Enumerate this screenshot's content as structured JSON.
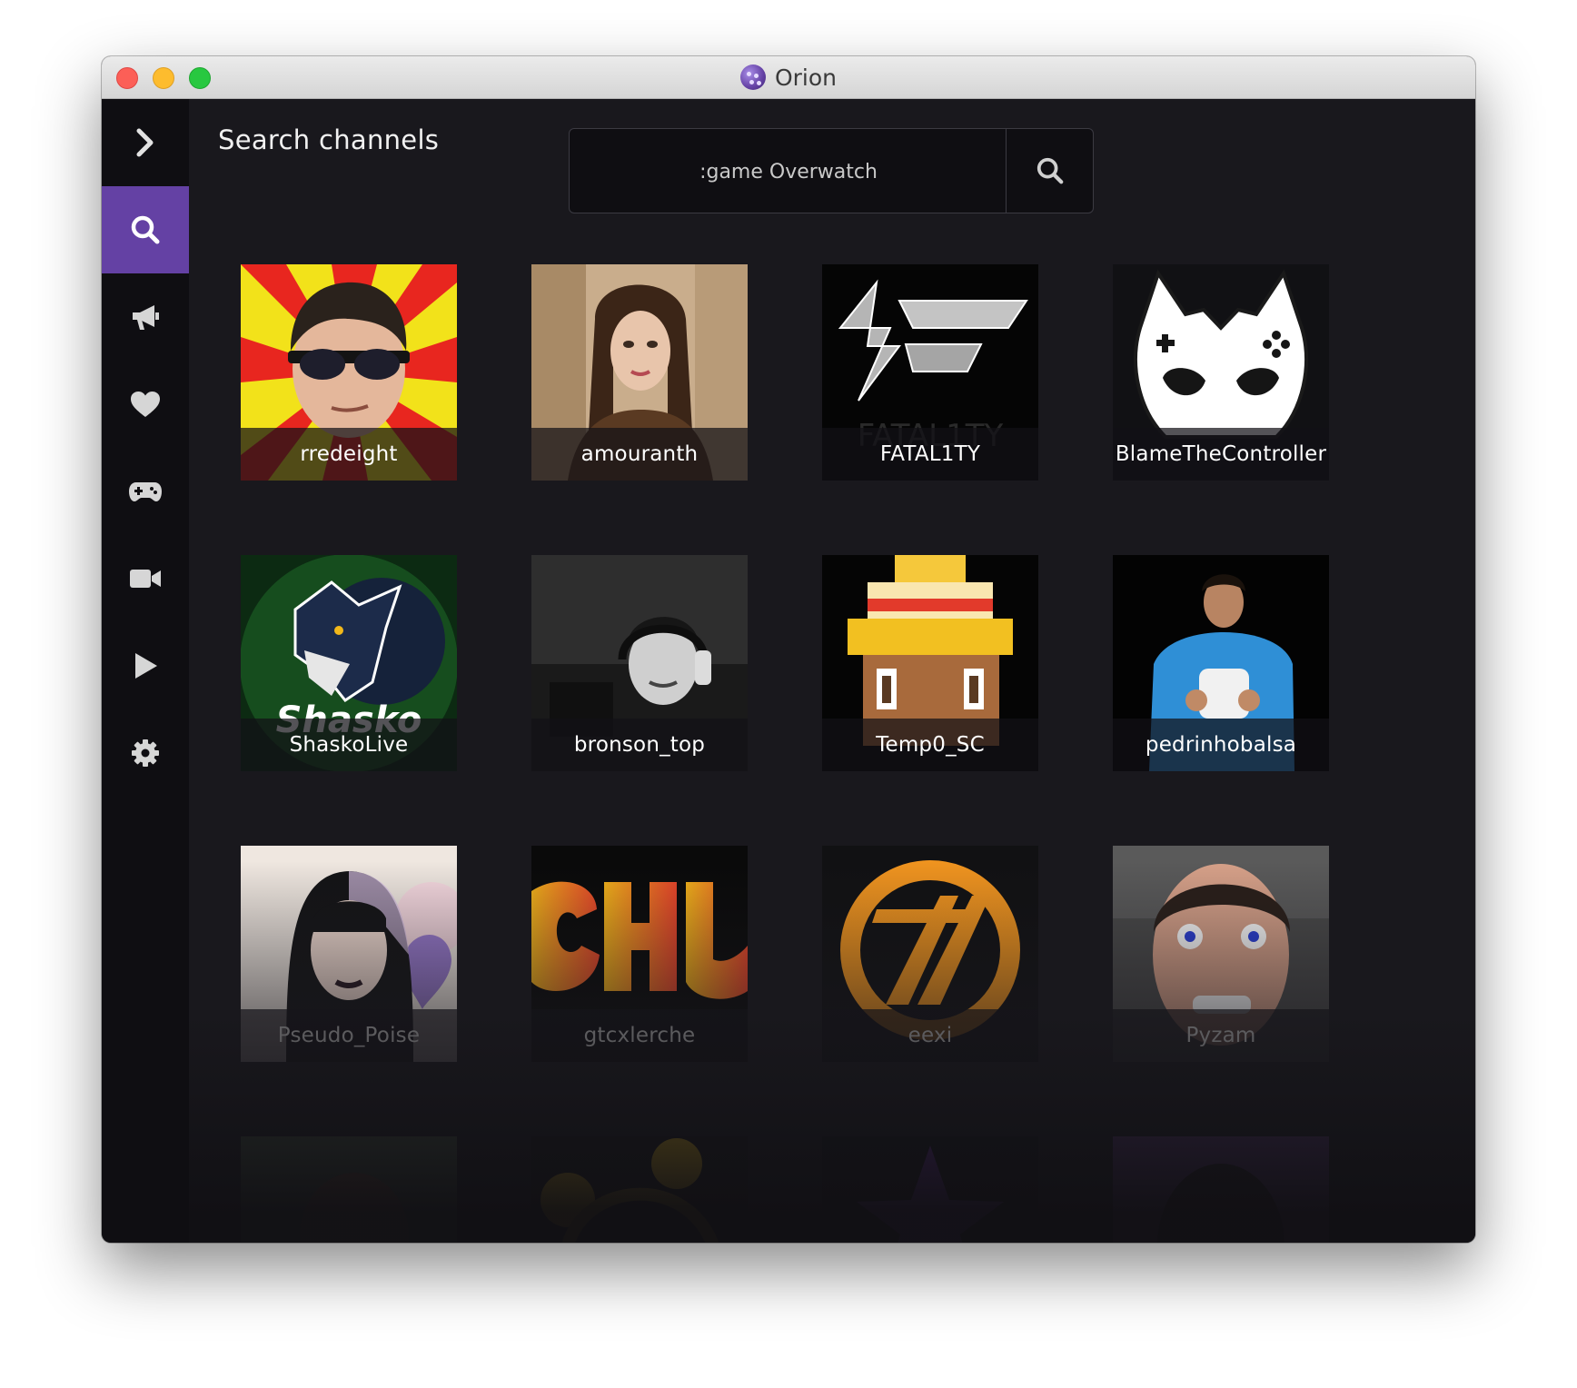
{
  "window": {
    "title": "Orion"
  },
  "sidebar": {
    "items": [
      {
        "icon": "chevron-right-icon"
      },
      {
        "icon": "search-icon",
        "active": true
      },
      {
        "icon": "megaphone-icon"
      },
      {
        "icon": "heart-icon"
      },
      {
        "icon": "gamepad-icon"
      },
      {
        "icon": "video-camera-icon"
      },
      {
        "icon": "play-icon"
      },
      {
        "icon": "settings-gear-icon"
      }
    ],
    "accent_color": "#6441a4"
  },
  "header": {
    "title": "Search channels"
  },
  "search": {
    "value": ":game Overwatch",
    "button_icon": "search-icon"
  },
  "channels": [
    {
      "name": "rredeight"
    },
    {
      "name": "amouranth"
    },
    {
      "name": "FATAL1TY"
    },
    {
      "name": "BlameTheController"
    },
    {
      "name": "ShaskoLive"
    },
    {
      "name": "bronson_top"
    },
    {
      "name": "Temp0_SC"
    },
    {
      "name": "pedrinhobalsa"
    },
    {
      "name": "Pseudo_Poise"
    },
    {
      "name": "gtcxlerche"
    },
    {
      "name": "eexi"
    },
    {
      "name": "Pyzam"
    }
  ]
}
